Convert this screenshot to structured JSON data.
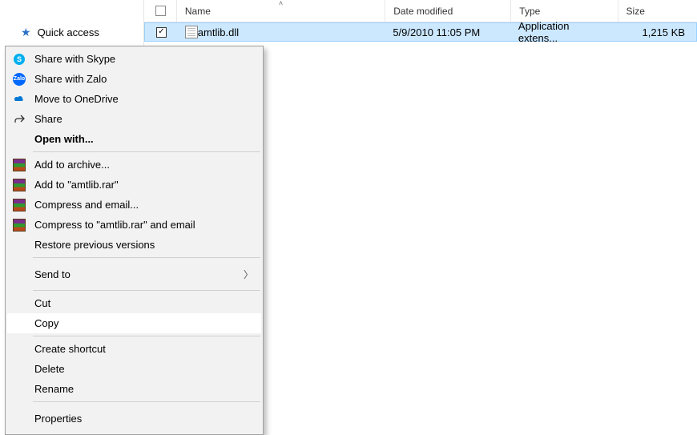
{
  "nav": {
    "quick_access": "Quick access"
  },
  "headers": {
    "name": "Name",
    "date": "Date modified",
    "type": "Type",
    "size": "Size"
  },
  "row": {
    "name": "amtlib.dll",
    "date": "5/9/2010 11:05 PM",
    "type": "Application extens...",
    "size": "1,215 KB",
    "checked": "✓"
  },
  "menu": {
    "share_skype": "Share with Skype",
    "share_zalo": "Share with Zalo",
    "move_onedrive": "Move to OneDrive",
    "share": "Share",
    "open_with": "Open with...",
    "add_archive": "Add to archive...",
    "add_named": "Add to \"amtlib.rar\"",
    "compress_email": "Compress and email...",
    "compress_named_email": "Compress to \"amtlib.rar\" and email",
    "restore_prev": "Restore previous versions",
    "send_to": "Send to",
    "cut": "Cut",
    "copy": "Copy",
    "create_shortcut": "Create shortcut",
    "delete": "Delete",
    "rename": "Rename",
    "properties": "Properties",
    "zalo_badge": "Zalo"
  }
}
